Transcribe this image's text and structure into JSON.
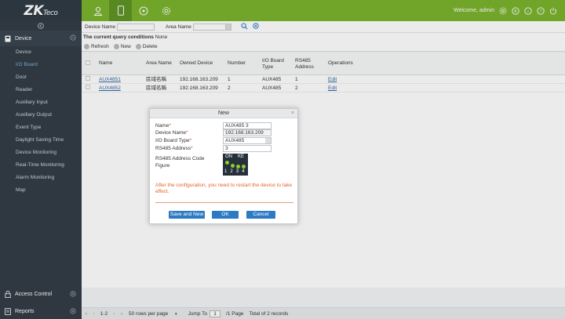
{
  "brand": {
    "logo_main": "ZK",
    "logo_sub": "Teco"
  },
  "topnav": {
    "icons": [
      "person-icon",
      "tablet-icon",
      "clock-icon",
      "gear-icon"
    ],
    "active_index": 1
  },
  "header": {
    "welcome": "Welcome, admin",
    "icons": [
      "settings-icon",
      "registered-icon",
      "info-icon",
      "help-icon",
      "power-icon"
    ]
  },
  "sidebar": {
    "module": "Device",
    "items": [
      {
        "label": "Device",
        "active": false
      },
      {
        "label": "I/O Board",
        "active": true
      },
      {
        "label": "Door",
        "active": false
      },
      {
        "label": "Reader",
        "active": false
      },
      {
        "label": "Auxiliary Input",
        "active": false
      },
      {
        "label": "Auxiliary Output",
        "active": false
      },
      {
        "label": "Event Type",
        "active": false
      },
      {
        "label": "Daylight Saving Time",
        "active": false
      },
      {
        "label": "Device Monitoring",
        "active": false
      },
      {
        "label": "Real-Time Monitoring",
        "active": false
      },
      {
        "label": "Alarm Monitoring",
        "active": false
      },
      {
        "label": "Map",
        "active": false
      }
    ],
    "bottom_modules": [
      "Access Control",
      "Reports"
    ]
  },
  "search": {
    "device_name_label": "Device Name",
    "device_name_value": "",
    "area_name_label": "Area Name",
    "area_name_value": ""
  },
  "query_conditions": {
    "label": "The current query conditions",
    "value": "None"
  },
  "toolbar": {
    "refresh": "Refresh",
    "new": "New",
    "delete": "Delete"
  },
  "table": {
    "columns": [
      "Name",
      "Area Name",
      "Owned Device",
      "Number",
      "I/O Board Type",
      "RS485 Address",
      "Operations"
    ],
    "rows": [
      {
        "name": "AUX4851",
        "area": "區域名稱",
        "device": "192.168.163.209",
        "number": "1",
        "type": "AUX485",
        "rs485": "1",
        "op": "Edit"
      },
      {
        "name": "AUX4852",
        "area": "區域名稱",
        "device": "192.168.163.209",
        "number": "2",
        "type": "AUX485",
        "rs485": "2",
        "op": "Edit"
      }
    ]
  },
  "pager": {
    "range": "1-2",
    "per_page": "50 rows per page",
    "jump_to": "Jump To",
    "page_value": "1",
    "page_total": "/1 Page",
    "total": "Total of 2 records"
  },
  "dialog": {
    "title": "New",
    "name_label": "Name",
    "name_value": "AUX485 3",
    "device_name_label": "Device Name",
    "device_name_value": "192.168.163.209",
    "board_type_label": "I/O Board Type",
    "board_type_value": "AUX485",
    "rs485_label": "RS485 Address",
    "rs485_value": "3",
    "code_label": "RS485 Address Code Figure",
    "code_on": "ON",
    "code_ke": "KE",
    "code_nums": "1 2 3 4",
    "note": "After the configuration, you need to restart the device to take effect.",
    "save_new": "Save and New",
    "ok": "OK",
    "cancel": "Cancel",
    "close_glyph": "×",
    "required_mark": "*"
  },
  "colors": {
    "topbar": "#7bb32e",
    "sidebar": "#333d47",
    "button": "#2d7ac4",
    "note": "#e4632a",
    "link": "#3668a8"
  }
}
